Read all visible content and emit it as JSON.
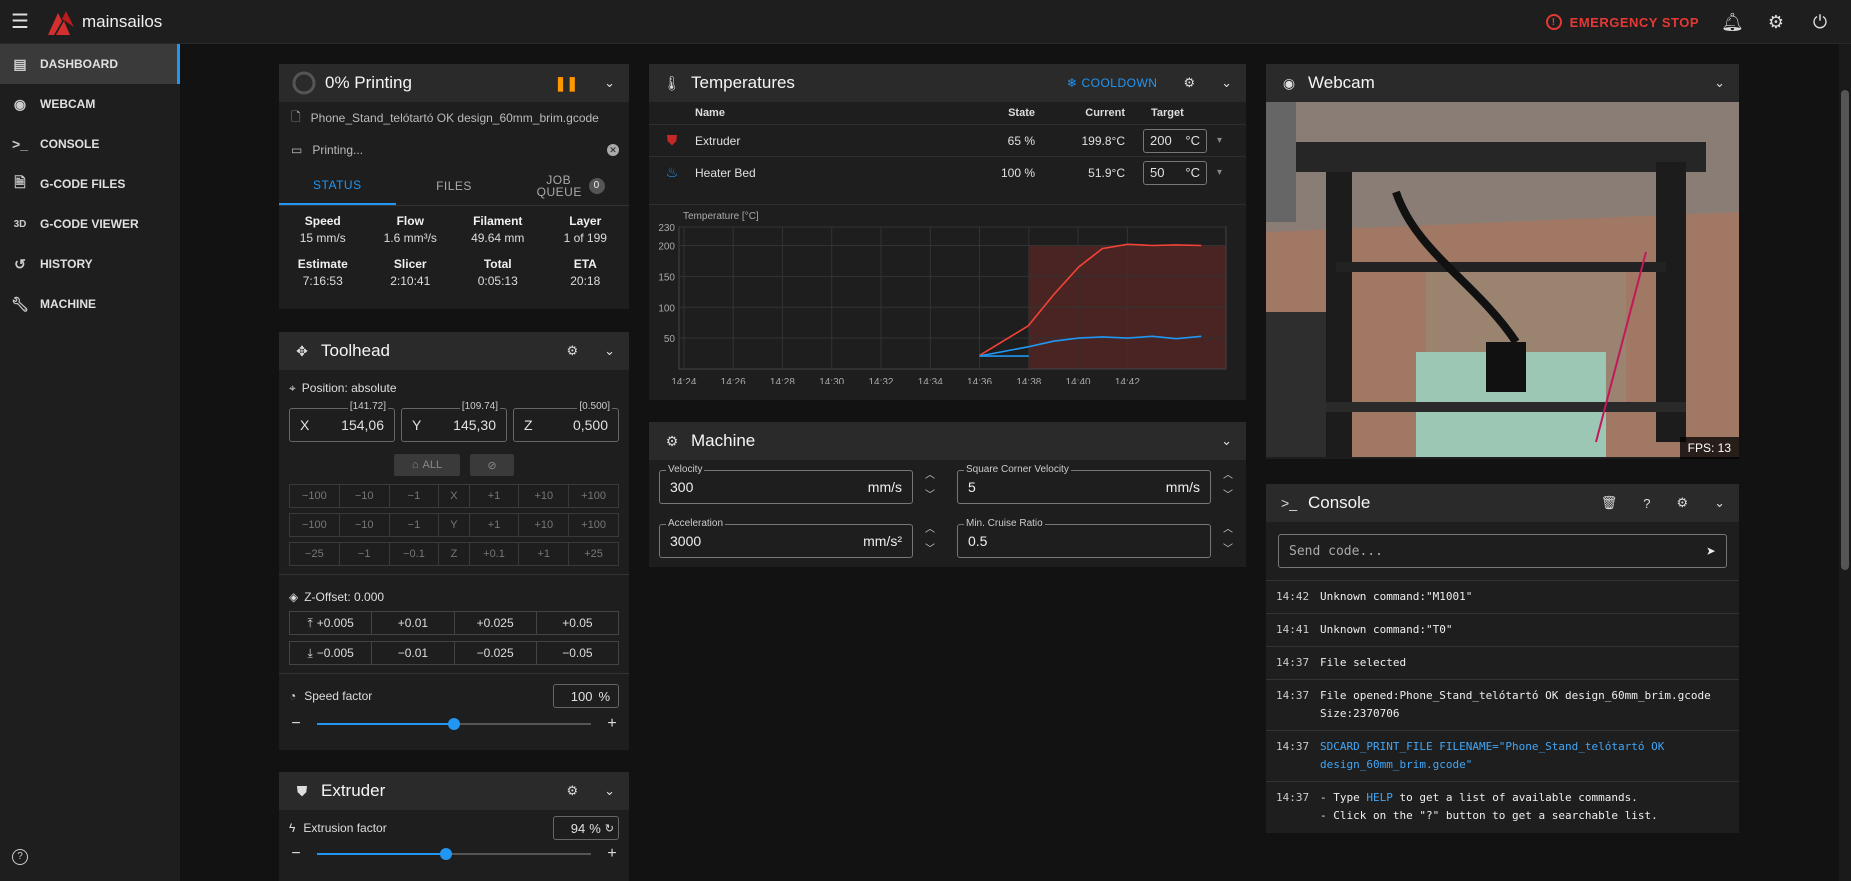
{
  "app": {
    "name": "mainsailos",
    "emergency_label": "EMERGENCY STOP"
  },
  "sidebar": {
    "items": [
      {
        "label": "DASHBOARD",
        "icon": "dashboard-icon"
      },
      {
        "label": "WEBCAM",
        "icon": "webcam-icon"
      },
      {
        "label": "CONSOLE",
        "icon": "console-icon"
      },
      {
        "label": "G-CODE FILES",
        "icon": "file-icon"
      },
      {
        "label": "G-CODE VIEWER",
        "icon": "3d-icon"
      },
      {
        "label": "HISTORY",
        "icon": "history-icon"
      },
      {
        "label": "MACHINE",
        "icon": "wrench-icon"
      }
    ],
    "viewer_glyph": "3D"
  },
  "status": {
    "title": "0% Printing",
    "filename": "Phone_Stand_telótartó OK design_60mm_brim.gcode",
    "message": "Printing...",
    "tabs": [
      "STATUS",
      "FILES",
      "JOB QUEUE"
    ],
    "queue_count": "0",
    "stats1": [
      {
        "label": "Speed",
        "value": "15 mm/s"
      },
      {
        "label": "Flow",
        "value": "1.6 mm³/s"
      },
      {
        "label": "Filament",
        "value": "49.64 mm"
      },
      {
        "label": "Layer",
        "value": "1 of 199"
      }
    ],
    "stats2": [
      {
        "label": "Estimate",
        "value": "7:16:53"
      },
      {
        "label": "Slicer",
        "value": "2:10:41"
      },
      {
        "label": "Total",
        "value": "0:05:13"
      },
      {
        "label": "ETA",
        "value": "20:18"
      }
    ]
  },
  "toolhead": {
    "title": "Toolhead",
    "position_label": "Position: absolute",
    "axes": [
      {
        "name": "X",
        "value": "154,06",
        "limit": "[141.72]"
      },
      {
        "name": "Y",
        "value": "145,30",
        "limit": "[109.74]"
      },
      {
        "name": "Z",
        "value": "0,500",
        "limit": "[0.500]"
      }
    ],
    "home_all": "ALL",
    "jog_x": [
      "−100",
      "−10",
      "−1",
      "X",
      "+1",
      "+10",
      "+100"
    ],
    "jog_y": [
      "−100",
      "−10",
      "−1",
      "Y",
      "+1",
      "+10",
      "+100"
    ],
    "jog_z": [
      "−25",
      "−1",
      "−0.1",
      "Z",
      "+0.1",
      "+1",
      "+25"
    ],
    "zoffset_label": "Z-Offset: 0.000",
    "zoffset_up": [
      "+0.005",
      "+0.01",
      "+0.025",
      "+0.05"
    ],
    "zoffset_down": [
      "−0.005",
      "−0.01",
      "−0.025",
      "−0.05"
    ],
    "speed_label": "Speed factor",
    "speed_value": "100",
    "speed_unit": "%",
    "speed_fraction": 0.5
  },
  "extruder": {
    "title": "Extruder",
    "factor_label": "Extrusion factor",
    "factor_value": "94",
    "factor_unit": "%",
    "factor_fraction": 0.47
  },
  "temperatures": {
    "title": "Temperatures",
    "cooldown": "COOLDOWN",
    "columns": {
      "name": "Name",
      "state": "State",
      "current": "Current",
      "target": "Target"
    },
    "rows": [
      {
        "name": "Extruder",
        "state": "65 %",
        "current": "199.8°C",
        "target": "200",
        "unit": "°C"
      },
      {
        "name": "Heater Bed",
        "state": "100 %",
        "current": "51.9°C",
        "target": "50",
        "unit": "°C"
      }
    ]
  },
  "chart_data": {
    "type": "line",
    "ylabel": "Temperature [°C]",
    "ylim": [
      0,
      230
    ],
    "y_ticks": [
      "230",
      "200",
      "150",
      "100",
      "50"
    ],
    "x_ticks": [
      "14:24",
      "14:26",
      "14:28",
      "14:30",
      "14:32",
      "14:34",
      "14:36",
      "14:38",
      "14:40",
      "14:42"
    ],
    "series": [
      {
        "name": "Extruder",
        "color": "#f44336",
        "x": [
          14.6,
          14.633,
          14.65,
          14.667,
          14.683,
          14.7,
          14.717,
          14.733,
          14.75
        ],
        "y": [
          22,
          70,
          120,
          165,
          195,
          202,
          200,
          201,
          200
        ]
      },
      {
        "name": "Heater Bed",
        "color": "#2196f3",
        "x": [
          14.6,
          14.633,
          14.65,
          14.667,
          14.683,
          14.7,
          14.717,
          14.733,
          14.75
        ],
        "y": [
          21,
          36,
          45,
          50,
          52,
          50,
          53,
          49,
          53
        ]
      }
    ],
    "x_start": 14.3967,
    "heating_start": 14.6333
  },
  "machine": {
    "title": "Machine",
    "fields": [
      {
        "label": "Velocity",
        "value": "300",
        "unit": "mm/s"
      },
      {
        "label": "Square Corner Velocity",
        "value": "5",
        "unit": "mm/s"
      },
      {
        "label": "Acceleration",
        "value": "3000",
        "unit": "mm/s²"
      },
      {
        "label": "Min. Cruise Ratio",
        "value": "0.5",
        "unit": ""
      }
    ]
  },
  "webcam": {
    "title": "Webcam",
    "fps": "FPS: 13"
  },
  "console": {
    "title": "Console",
    "placeholder": "Send code...",
    "logs": [
      {
        "time": "14:42",
        "msg": "Unknown command:\"M1001\"",
        "type": "text"
      },
      {
        "time": "14:41",
        "msg": "Unknown command:\"T0\"",
        "type": "text"
      },
      {
        "time": "14:37",
        "msg": "File selected",
        "type": "text"
      },
      {
        "time": "14:37",
        "msg": "File opened:Phone_Stand_telótartó OK design_60mm_brim.gcode\nSize:2370706",
        "type": "text"
      },
      {
        "time": "14:37",
        "msg": "SDCARD_PRINT_FILE FILENAME=\"Phone_Stand_telótartó OK\ndesign_60mm_brim.gcode\"",
        "type": "cmd"
      }
    ],
    "help_pre": "- Type ",
    "help_word": "HELP",
    "help_post": " to get a list of available commands.",
    "help_line2": "- Click on the \"?\" button to get a searchable list."
  }
}
